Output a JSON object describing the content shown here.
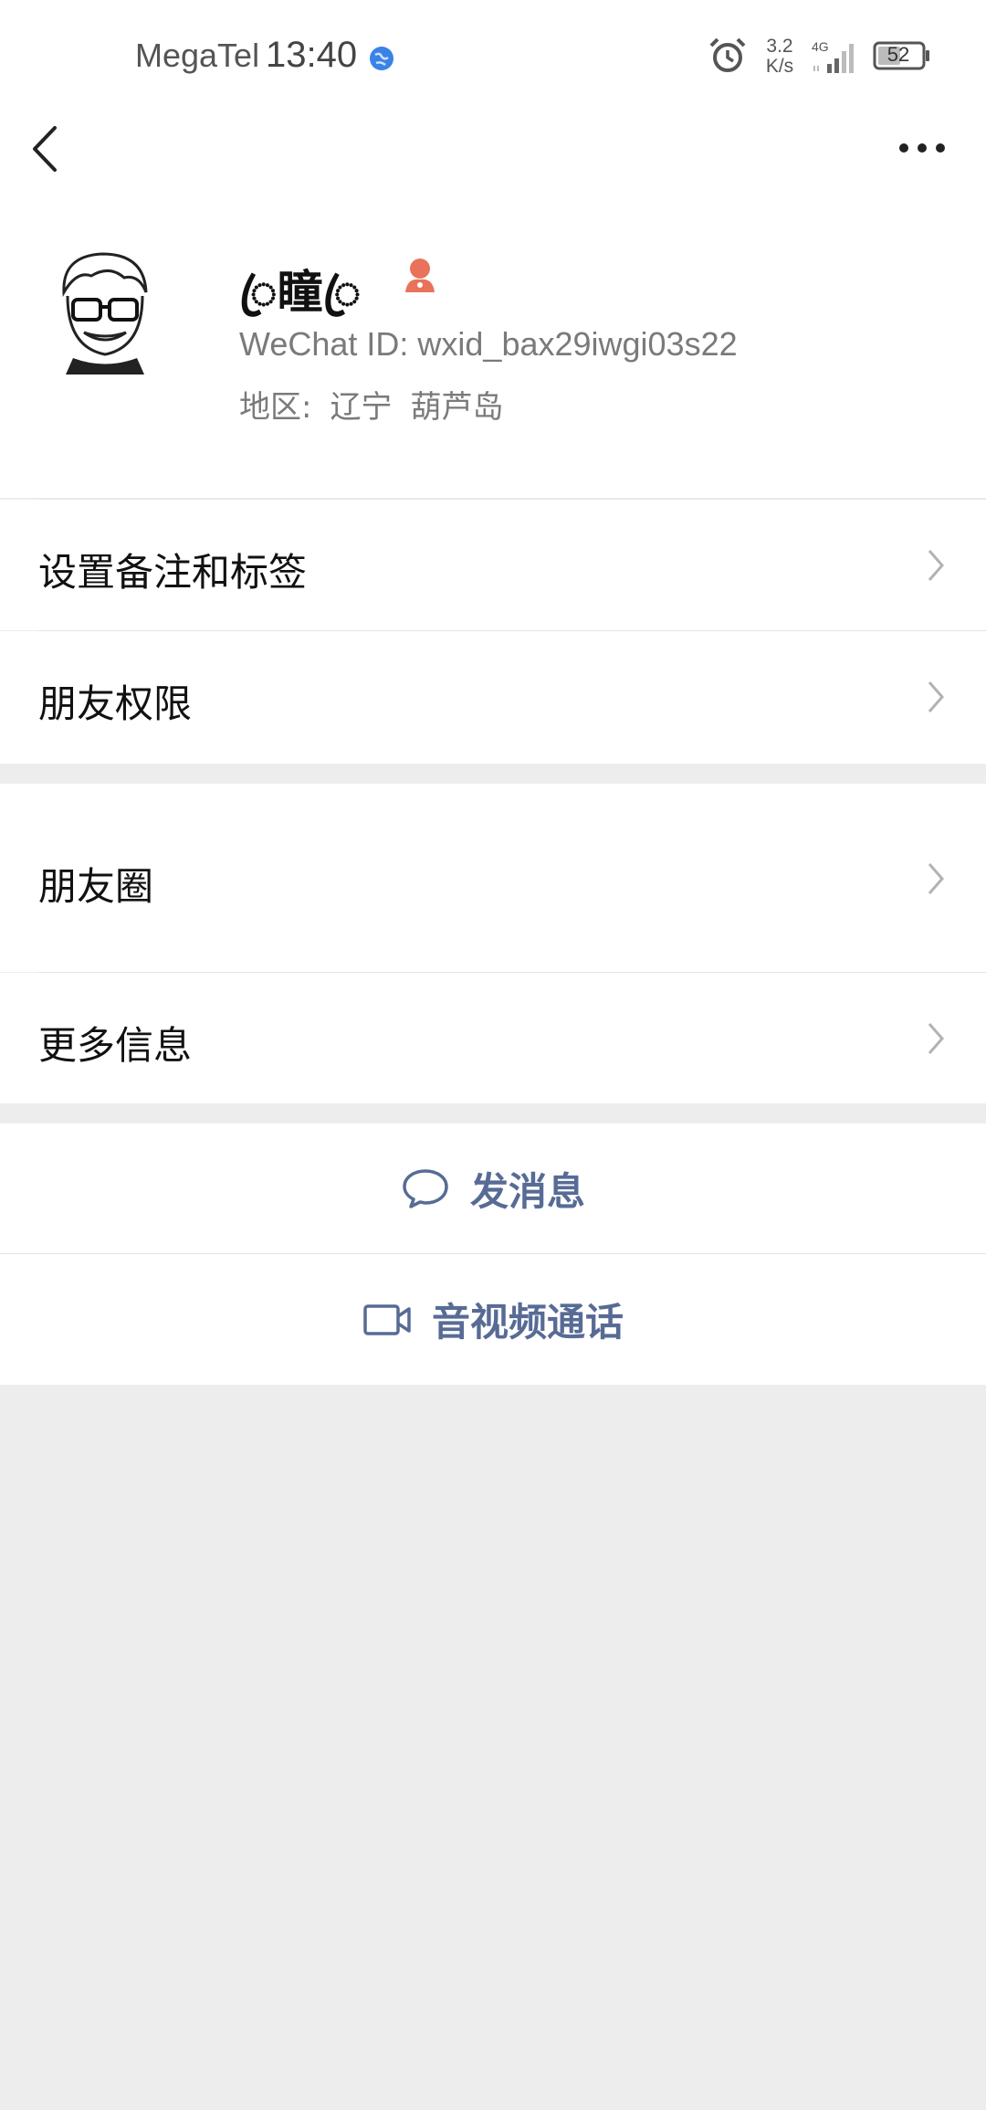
{
  "status_bar": {
    "carrier": "MegaTel",
    "time": "13:40",
    "net_speed_value": "3.2",
    "net_speed_unit": "K/s",
    "network_type": "4G",
    "battery": "52"
  },
  "profile": {
    "nickname": "ꦿ瞳ꦿ",
    "wechat_id": "WeChat ID:  wxid_bax29iwgi03s22",
    "region_label": "地区:",
    "region_province": "辽宁",
    "region_city": "葫芦岛"
  },
  "menu": {
    "remark_tags": "设置备注和标签",
    "friend_permissions": "朋友权限",
    "moments": "朋友圈",
    "more_info": "更多信息"
  },
  "actions": {
    "send_message": "发消息",
    "video_call": "音视频通话"
  },
  "colors": {
    "accent_link": "#576b95",
    "gender_icon": "#e8735a",
    "background": "#ededed"
  }
}
